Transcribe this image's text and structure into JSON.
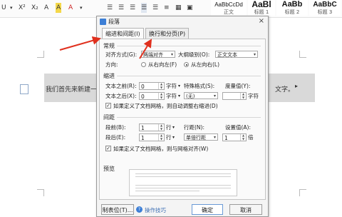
{
  "toolbar": {
    "left_tools": [
      "U",
      "X²",
      "X₂",
      "A",
      "A",
      "A"
    ],
    "styles": [
      {
        "preview": "AaBbCcDd",
        "name": "正文"
      },
      {
        "preview": "AaBl",
        "name": "标题 1"
      },
      {
        "preview": "AaBb",
        "name": "标题 2"
      },
      {
        "preview": "AaBbC",
        "name": "标题 3"
      }
    ]
  },
  "document": {
    "line_text": "我们首先来新建一",
    "line_end": "文字。"
  },
  "dialog": {
    "title": "段落",
    "tabs": [
      "缩进和间距(I)",
      "换行和分页(P)"
    ],
    "general": {
      "heading": "常规",
      "alignment_label": "对齐方式(G):",
      "alignment_value": "两端对齐",
      "outline_label": "大纲级别(O):",
      "outline_value": "正文文本",
      "direction_label": "方向:",
      "rtl_label": "从右向左(F)",
      "ltr_label": "从左向右(L)"
    },
    "indent": {
      "heading": "缩进",
      "before_label": "文本之前(R):",
      "before_value": "0",
      "before_unit": "字符",
      "after_label": "文本之后(X):",
      "after_value": "0",
      "after_unit": "字符",
      "special_label": "特殊格式(S):",
      "special_value": "(无)",
      "measure_label": "度量值(Y):",
      "measure_unit": "字符",
      "grid_check": "如果定义了文档网格，则自动调整右缩进(D)"
    },
    "spacing": {
      "heading": "间距",
      "before_label": "段前(B):",
      "before_value": "1",
      "before_unit": "行",
      "after_label": "段后(E):",
      "after_value": "1",
      "after_unit": "行",
      "line_label": "行距(N):",
      "line_value": "单倍行距",
      "set_label": "设置值(A):",
      "set_value": "1",
      "set_unit": "倍",
      "grid_check": "如果定义了文档网格，则与网格对齐(W)"
    },
    "preview": {
      "heading": "预览"
    },
    "buttons": {
      "tabs": "制表位(T)...",
      "help": "操作技巧",
      "ok": "确定",
      "cancel": "取消"
    }
  },
  "colors": {
    "annotation_arrow": "#e0301e",
    "accent": "#3d7fd6"
  }
}
